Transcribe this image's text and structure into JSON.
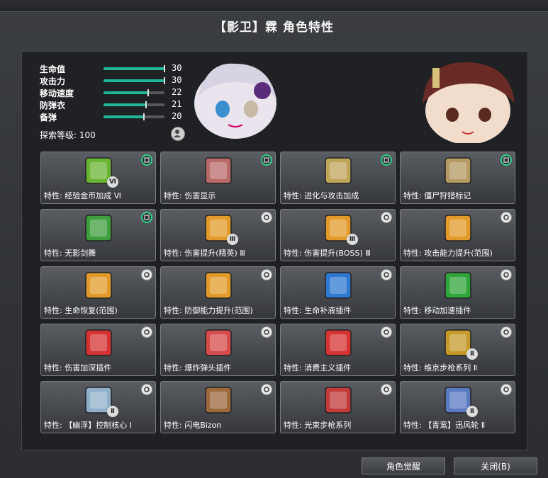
{
  "title": "【影卫】霖 角色特性",
  "stats": [
    {
      "label": "生命值",
      "value": "30",
      "fill": 1.0
    },
    {
      "label": "攻击力",
      "value": "30",
      "fill": 1.0
    },
    {
      "label": "移动速度",
      "value": "22",
      "fill": 0.73
    },
    {
      "label": "防弹衣",
      "value": "21",
      "fill": 0.7
    },
    {
      "label": "备弹",
      "value": "20",
      "fill": 0.66
    }
  ],
  "explore_label": "探索等级: 100",
  "cards": [
    {
      "label": "特性: 经验金币加成 Ⅵ",
      "icon": "book-icon",
      "color": "#6ab434",
      "badge": "book-badge-icon",
      "green": true,
      "roman": "Ⅵ"
    },
    {
      "label": "特性: 伤害显示",
      "icon": "damage-display-icon",
      "color": "#b86a68",
      "badge": "eye-badge-icon",
      "green": true,
      "roman": ""
    },
    {
      "label": "特性: 进化与攻击加成",
      "icon": "dna-icon",
      "color": "#bfa55a",
      "badge": "dna-badge-icon",
      "green": true,
      "roman": ""
    },
    {
      "label": "特性: 僵尸狩猎标记",
      "icon": "zombie-mark-icon",
      "color": "#b59a63",
      "badge": "dna-badge-icon",
      "green": true,
      "roman": ""
    },
    {
      "label": "特性: 无影剑舞",
      "icon": "shadow-dance-icon",
      "color": "#3f9e3e",
      "badge": "hourglass-badge-icon",
      "green": true,
      "roman": ""
    },
    {
      "label": "特性: 伤害提升(精英) Ⅲ",
      "icon": "elite-damage-icon",
      "color": "#e29a2a",
      "badge": "gear-badge-icon",
      "green": false,
      "roman": "Ⅲ"
    },
    {
      "label": "特性: 伤害提升(BOSS) Ⅲ",
      "icon": "boss-damage-icon",
      "color": "#e29a2a",
      "badge": "gear-badge-icon",
      "green": false,
      "roman": "Ⅲ"
    },
    {
      "label": "特性: 攻击能力提升(范围)",
      "icon": "attack-area-icon",
      "color": "#e29a2a",
      "badge": "gear-badge-icon",
      "green": false,
      "roman": ""
    },
    {
      "label": "特性: 生命恢复(范围)",
      "icon": "heal-area-icon",
      "color": "#e29a2a",
      "badge": "gear-badge-icon",
      "green": false,
      "roman": ""
    },
    {
      "label": "特性: 防御能力提升(范围)",
      "icon": "defense-area-icon",
      "color": "#e29a2a",
      "badge": "gear-badge-icon",
      "green": false,
      "roman": ""
    },
    {
      "label": "特性: 生命补液插件",
      "icon": "life-plugin-icon",
      "color": "#2f7ad0",
      "badge": "list-badge-icon",
      "green": false,
      "roman": ""
    },
    {
      "label": "特性: 移动加速插件",
      "icon": "speed-plugin-icon",
      "color": "#2fa53a",
      "badge": "list-badge-icon",
      "green": false,
      "roman": ""
    },
    {
      "label": "特性: 伤害加深插件",
      "icon": "damage-plugin-icon",
      "color": "#d63232",
      "badge": "list-badge-icon",
      "green": false,
      "roman": ""
    },
    {
      "label": "特性: 爆炸弹头插件",
      "icon": "explosive-plugin-icon",
      "color": "#d64b4b",
      "badge": "list-badge-icon",
      "green": false,
      "roman": ""
    },
    {
      "label": "特性: 消费主义插件",
      "icon": "consumer-plugin-icon",
      "color": "#d63232",
      "badge": "list-badge-icon",
      "green": false,
      "roman": ""
    },
    {
      "label": "特性: 维京步枪系列 Ⅱ",
      "icon": "viking-rifle-icon",
      "color": "#c59a2a",
      "badge": "rifle-badge-icon",
      "green": false,
      "roman": "Ⅱ"
    },
    {
      "label": "特性: 【幽浮】控制核心 Ⅰ",
      "icon": "ufo-core-icon",
      "color": "#8fb0c8",
      "badge": "rifle-badge-icon",
      "green": false,
      "roman": "Ⅱ"
    },
    {
      "label": "特性: 闪电Bizon",
      "icon": "bizon-icon",
      "color": "#9c6a3c",
      "badge": "rifle-badge-icon",
      "green": false,
      "roman": ""
    },
    {
      "label": "特性: 光束步枪系列",
      "icon": "beam-rifle-icon",
      "color": "#c23a3a",
      "badge": "rifle-badge-icon",
      "green": false,
      "roman": ""
    },
    {
      "label": "特性: 【青鸾】迅风轮 Ⅱ",
      "icon": "wind-wheel-icon",
      "color": "#5a7ac0",
      "badge": "rifle-badge-icon",
      "green": false,
      "roman": "Ⅱ"
    }
  ],
  "buttons": {
    "awaken": "角色觉醒",
    "close": "关闭(B)"
  }
}
